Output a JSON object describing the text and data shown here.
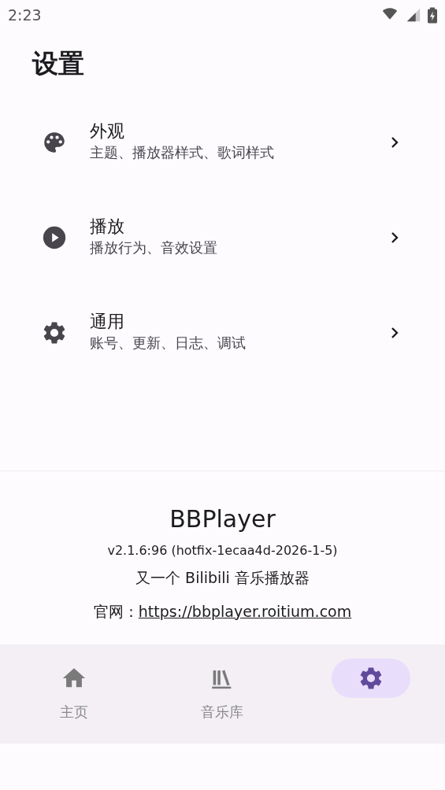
{
  "status_bar": {
    "time": "2:23"
  },
  "title": "设置",
  "settings": [
    {
      "title": "外观",
      "subtitle": "主题、播放器样式、歌词样式"
    },
    {
      "title": "播放",
      "subtitle": "播放行为、音效设置"
    },
    {
      "title": "通用",
      "subtitle": "账号、更新、日志、调试"
    }
  ],
  "about": {
    "app_name": "BBPlayer",
    "version": "v2.1.6:96 (hotfix-1ecaa4d-2026-1-5)",
    "tagline": "又一个 Bilibili 音乐播放器",
    "website_label": "官网：",
    "website_link": "https://bbplayer.roitium.com"
  },
  "nav": [
    {
      "label": "主页",
      "selected": false
    },
    {
      "label": "音乐库",
      "selected": false
    },
    {
      "selected": true
    }
  ]
}
